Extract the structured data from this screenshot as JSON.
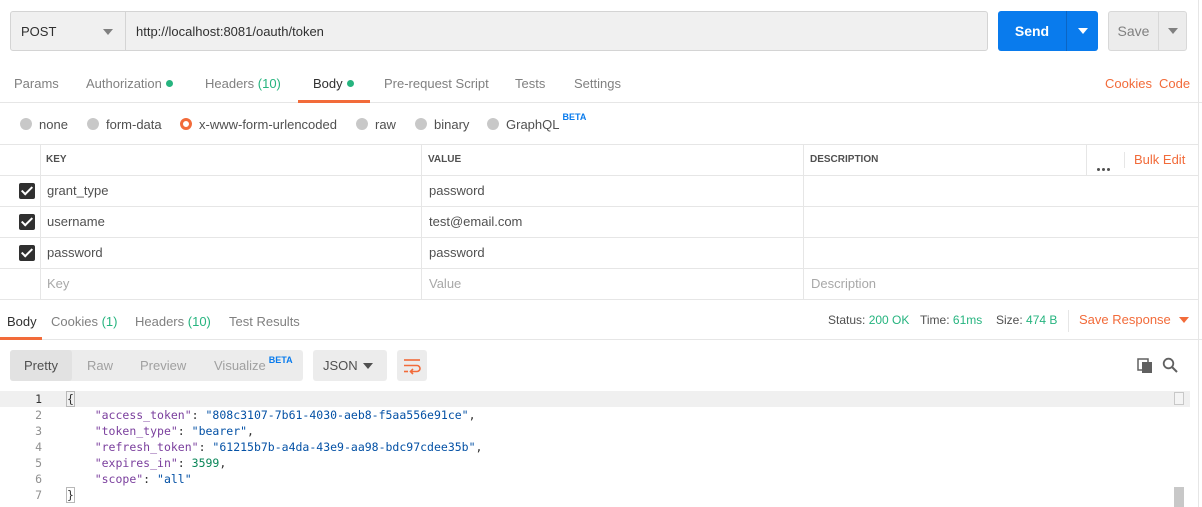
{
  "request": {
    "method": "POST",
    "url": "http://localhost:8081/oauth/token",
    "send_label": "Send",
    "save_label": "Save"
  },
  "request_tabs": [
    {
      "label": "Params",
      "count": "",
      "dot": false,
      "active": false
    },
    {
      "label": "Authorization",
      "count": "",
      "dot": true,
      "active": false
    },
    {
      "label": "Headers",
      "count": "(10)",
      "dot": false,
      "active": false
    },
    {
      "label": "Body",
      "count": "",
      "dot": true,
      "active": true
    },
    {
      "label": "Pre-request Script",
      "count": "",
      "dot": false,
      "active": false
    },
    {
      "label": "Tests",
      "count": "",
      "dot": false,
      "active": false
    },
    {
      "label": "Settings",
      "count": "",
      "dot": false,
      "active": false
    }
  ],
  "links": {
    "cookies": "Cookies",
    "code": "Code"
  },
  "body_types": [
    {
      "label": "none",
      "selected": false,
      "badge": ""
    },
    {
      "label": "form-data",
      "selected": false,
      "badge": ""
    },
    {
      "label": "x-www-form-urlencoded",
      "selected": true,
      "badge": ""
    },
    {
      "label": "raw",
      "selected": false,
      "badge": ""
    },
    {
      "label": "binary",
      "selected": false,
      "badge": ""
    },
    {
      "label": "GraphQL",
      "selected": false,
      "badge": "BETA"
    }
  ],
  "params_table": {
    "headers": {
      "key": "KEY",
      "value": "VALUE",
      "description": "DESCRIPTION"
    },
    "bulk_edit": "Bulk Edit",
    "rows": [
      {
        "checked": true,
        "key": "grant_type",
        "value": "password",
        "description": ""
      },
      {
        "checked": true,
        "key": "username",
        "value": "test@email.com",
        "description": ""
      },
      {
        "checked": true,
        "key": "password",
        "value": "password",
        "description": ""
      }
    ],
    "placeholders": {
      "key": "Key",
      "value": "Value",
      "description": "Description"
    }
  },
  "response_tabs": [
    {
      "label": "Body",
      "count": "",
      "active": true
    },
    {
      "label": "Cookies",
      "count": "(1)",
      "active": false
    },
    {
      "label": "Headers",
      "count": "(10)",
      "active": false
    },
    {
      "label": "Test Results",
      "count": "",
      "active": false
    }
  ],
  "response_status": {
    "status_label": "Status:",
    "status_value": "200 OK",
    "time_label": "Time:",
    "time_value": "61ms",
    "size_label": "Size:",
    "size_value": "474 B",
    "save_response": "Save Response"
  },
  "viewer": {
    "modes": [
      "Pretty",
      "Raw",
      "Preview",
      "Visualize"
    ],
    "visualize_badge": "BETA",
    "active_mode": "Pretty",
    "format": "JSON"
  },
  "response_body": [
    {
      "n": "1",
      "parts": [
        [
          "p",
          "{"
        ]
      ]
    },
    {
      "n": "2",
      "parts": [
        [
          "p",
          "    "
        ],
        [
          "key",
          "\"access_token\""
        ],
        [
          "p",
          ": "
        ],
        [
          "str",
          "\"808c3107-7b61-4030-aeb8-f5aa556e91ce\""
        ],
        [
          "p",
          ","
        ]
      ]
    },
    {
      "n": "3",
      "parts": [
        [
          "p",
          "    "
        ],
        [
          "key",
          "\"token_type\""
        ],
        [
          "p",
          ": "
        ],
        [
          "str",
          "\"bearer\""
        ],
        [
          "p",
          ","
        ]
      ]
    },
    {
      "n": "4",
      "parts": [
        [
          "p",
          "    "
        ],
        [
          "key",
          "\"refresh_token\""
        ],
        [
          "p",
          ": "
        ],
        [
          "str",
          "\"61215b7b-a4da-43e9-aa98-bdc97cdee35b\""
        ],
        [
          "p",
          ","
        ]
      ]
    },
    {
      "n": "5",
      "parts": [
        [
          "p",
          "    "
        ],
        [
          "key",
          "\"expires_in\""
        ],
        [
          "p",
          ": "
        ],
        [
          "num",
          "3599"
        ],
        [
          "p",
          ","
        ]
      ]
    },
    {
      "n": "6",
      "parts": [
        [
          "p",
          "    "
        ],
        [
          "key",
          "\"scope\""
        ],
        [
          "p",
          ": "
        ],
        [
          "str",
          "\"all\""
        ]
      ]
    },
    {
      "n": "7",
      "parts": [
        [
          "p",
          "}"
        ]
      ]
    }
  ],
  "colors": {
    "accent": "#f26b3a",
    "send": "#097bed",
    "success": "#26b47f"
  },
  "icons": [
    "chevron-down-icon",
    "checkbox-icon",
    "more-icon",
    "copy-icon",
    "search-icon",
    "wrap-lines-icon"
  ]
}
